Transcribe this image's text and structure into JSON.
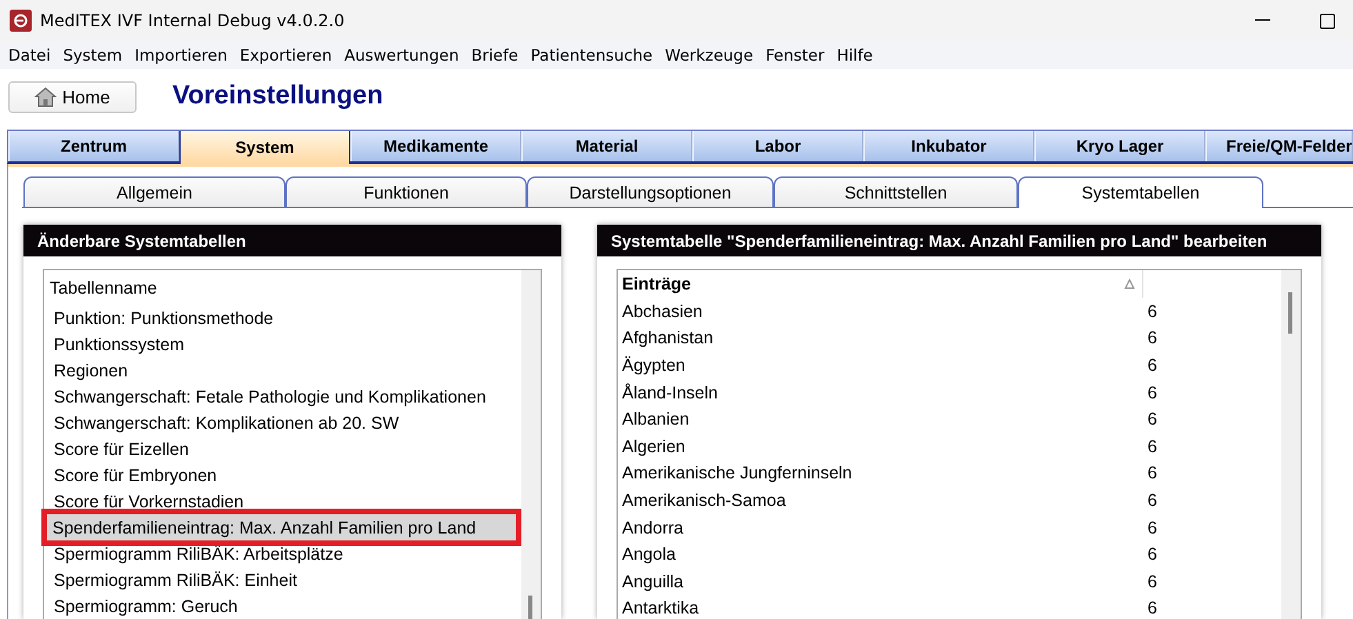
{
  "window": {
    "title": "MedITEX IVF Internal Debug v4.0.2.0"
  },
  "menu": [
    "Datei",
    "System",
    "Importieren",
    "Exportieren",
    "Auswertungen",
    "Briefe",
    "Patientensuche",
    "Werkzeuge",
    "Fenster",
    "Hilfe"
  ],
  "home_button": {
    "label": "Home"
  },
  "page_title": "Voreinstellungen",
  "main_tabs": [
    {
      "label": "Zentrum",
      "selected": false
    },
    {
      "label": "System",
      "selected": true
    },
    {
      "label": "Medikamente",
      "selected": false
    },
    {
      "label": "Material",
      "selected": false
    },
    {
      "label": "Labor",
      "selected": false
    },
    {
      "label": "Inkubator",
      "selected": false
    },
    {
      "label": "Kryo Lager",
      "selected": false
    },
    {
      "label": "Freie/QM-Felder",
      "selected": false
    }
  ],
  "sub_tabs": [
    {
      "label": "Allgemein",
      "selected": false
    },
    {
      "label": "Funktionen",
      "selected": false
    },
    {
      "label": "Darstellungsoptionen",
      "selected": false
    },
    {
      "label": "Schnittstellen",
      "selected": false
    },
    {
      "label": "Systemtabellen",
      "selected": true
    }
  ],
  "left_panel": {
    "title": "Änderbare Systemtabellen",
    "column": "Tabellenname",
    "rows": [
      {
        "label": "Punktion: Punktionsmethode",
        "selected": false
      },
      {
        "label": "Punktionssystem",
        "selected": false
      },
      {
        "label": "Regionen",
        "selected": false
      },
      {
        "label": "Schwangerschaft: Fetale Pathologie und Komplikationen",
        "selected": false
      },
      {
        "label": "Schwangerschaft: Komplikationen ab 20. SW",
        "selected": false
      },
      {
        "label": "Score für Eizellen",
        "selected": false
      },
      {
        "label": "Score für Embryonen",
        "selected": false
      },
      {
        "label": "Score für Vorkernstadien",
        "selected": false
      },
      {
        "label": "Spenderfamilieneintrag: Max. Anzahl Familien pro Land",
        "selected": true
      },
      {
        "label": "Spermiogramm RiliBÄK: Arbeitsplätze",
        "selected": false
      },
      {
        "label": "Spermiogramm RiliBÄK: Einheit",
        "selected": false
      },
      {
        "label": "Spermiogramm: Geruch",
        "selected": false
      }
    ]
  },
  "right_panel": {
    "title": "Systemtabelle \"Spenderfamilieneintrag: Max. Anzahl Familien pro Land\" bearbeiten",
    "column": "Einträge",
    "rows": [
      {
        "name": "Abchasien",
        "value": "6"
      },
      {
        "name": "Afghanistan",
        "value": "6"
      },
      {
        "name": "Ägypten",
        "value": "6"
      },
      {
        "name": "Åland-Inseln",
        "value": "6"
      },
      {
        "name": "Albanien",
        "value": "6"
      },
      {
        "name": "Algerien",
        "value": "6"
      },
      {
        "name": "Amerikanische Jungferninseln",
        "value": "6"
      },
      {
        "name": "Amerikanisch-Samoa",
        "value": "6"
      },
      {
        "name": "Andorra",
        "value": "6"
      },
      {
        "name": "Angola",
        "value": "6"
      },
      {
        "name": "Anguilla",
        "value": "6"
      },
      {
        "name": "Antarktika",
        "value": "6"
      }
    ]
  }
}
